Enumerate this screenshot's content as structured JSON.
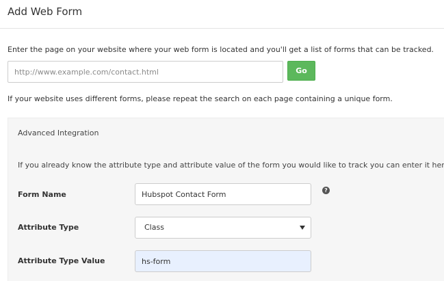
{
  "header": {
    "title": "Add Web Form"
  },
  "search": {
    "intro": "Enter the page on your website where your web form is located and you'll get a list of forms that can be tracked.",
    "url_placeholder": "http://www.example.com/contact.html",
    "url_value": "",
    "go_label": "Go",
    "go_color": "#5cb85c",
    "note": "If your website uses different forms, please repeat the search on each page containing a unique form."
  },
  "advanced": {
    "title": "Advanced Integration",
    "description": "If you already know the attribute type and attribute value of the form you would like to track you can enter it here.",
    "help_icon": "question-circle-icon",
    "fields": {
      "form_name": {
        "label": "Form Name",
        "value": "Hubspot Contact Form"
      },
      "attribute_type": {
        "label": "Attribute Type",
        "selected": "Class"
      },
      "attribute_type_value": {
        "label": "Attribute Type Value",
        "value": "hs-form"
      }
    }
  }
}
